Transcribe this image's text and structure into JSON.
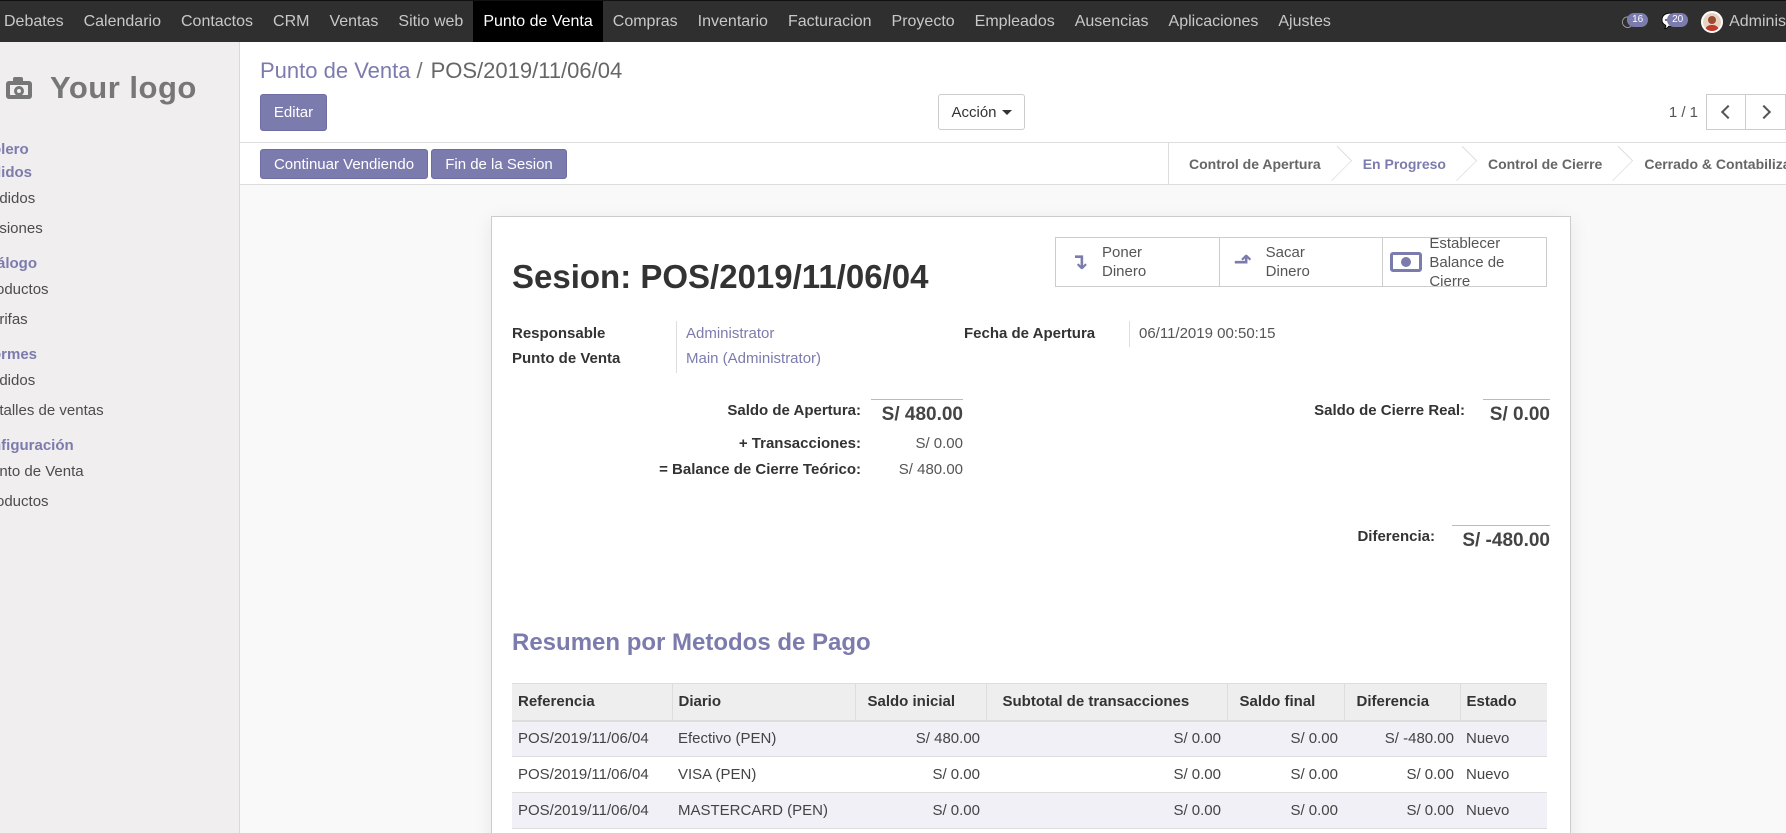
{
  "topbar": {
    "menu": [
      "Debates",
      "Calendario",
      "Contactos",
      "CRM",
      "Ventas",
      "Sitio web",
      "Punto de Venta",
      "Compras",
      "Inventario",
      "Facturacion",
      "Proyecto",
      "Empleados",
      "Ausencias",
      "Aplicaciones",
      "Ajustes"
    ],
    "active": "Punto de Venta",
    "activity_count": "16",
    "message_count": "20",
    "user_name": "Adminis"
  },
  "sidebar": {
    "logo_text": "Your logo",
    "groups": [
      {
        "label": "olero"
      },
      {
        "label": "didos"
      }
    ],
    "items": [
      {
        "label": "edidos"
      },
      {
        "label": "esiones"
      },
      {
        "label": "tálogo"
      },
      {
        "label": "roductos"
      },
      {
        "label": "arifas"
      },
      {
        "label": "ormes"
      },
      {
        "label": "edidos"
      },
      {
        "label": "etalles de ventas"
      },
      {
        "label": "nfiguración"
      },
      {
        "label": "unto de Venta"
      },
      {
        "label": "roductos"
      }
    ]
  },
  "control": {
    "breadcrumb_parent": "Punto de Venta",
    "breadcrumb_sep": "/",
    "breadcrumb_current": "POS/2019/11/06/04",
    "edit_label": "Editar",
    "action_label": "Acción",
    "pager_value": "1 / 1"
  },
  "statusbar": {
    "continue_label": "Continuar Vendiendo",
    "end_label": "Fin de la Sesion",
    "stages": [
      "Control de Apertura",
      "En Progreso",
      "Control de Cierre",
      "Cerrado & Contabilizado"
    ],
    "current_stage": "En Progreso"
  },
  "sheet": {
    "title": "Sesion: POS/2019/11/06/04",
    "buttons": {
      "put_money": "Poner\nDinero",
      "take_money": "Sacar\nDinero",
      "set_balance": "Establecer\nBalance de\nCierre"
    },
    "fields": {
      "responsible_label": "Responsable",
      "responsible_value": "Administrator",
      "pos_label": "Punto de Venta",
      "pos_value": "Main (Administrator)",
      "opening_date_label": "Fecha de Apertura",
      "opening_date_value": "06/11/2019 00:50:15"
    },
    "balances": {
      "opening_label": "Saldo de Apertura:",
      "opening_value": "S/ 480.00",
      "transactions_label": "+ Transacciones:",
      "transactions_value": "S/ 0.00",
      "theoretical_label": "= Balance de Cierre Teórico:",
      "theoretical_value": "S/ 480.00",
      "real_closing_label": "Saldo de Cierre Real:",
      "real_closing_value": "S/ 0.00",
      "difference_label": "Diferencia:",
      "difference_value": "S/ -480.00"
    },
    "section_title": "Resumen por Metodos de Pago",
    "table": {
      "headers": [
        "Referencia",
        "Diario",
        "Saldo inicial",
        "Subtotal de transacciones",
        "Saldo final",
        "Diferencia",
        "Estado"
      ],
      "rows": [
        [
          "POS/2019/11/06/04",
          "Efectivo (PEN)",
          "S/ 480.00",
          "S/ 0.00",
          "S/ 0.00",
          "S/ -480.00",
          "Nuevo"
        ],
        [
          "POS/2019/11/06/04",
          "VISA (PEN)",
          "S/ 0.00",
          "S/ 0.00",
          "S/ 0.00",
          "S/ 0.00",
          "Nuevo"
        ],
        [
          "POS/2019/11/06/04",
          "MASTERCARD (PEN)",
          "S/ 0.00",
          "S/ 0.00",
          "S/ 0.00",
          "S/ 0.00",
          "Nuevo"
        ]
      ]
    }
  },
  "colors": {
    "brand": "#7c7bad",
    "topbar": "#2f2f2f"
  }
}
